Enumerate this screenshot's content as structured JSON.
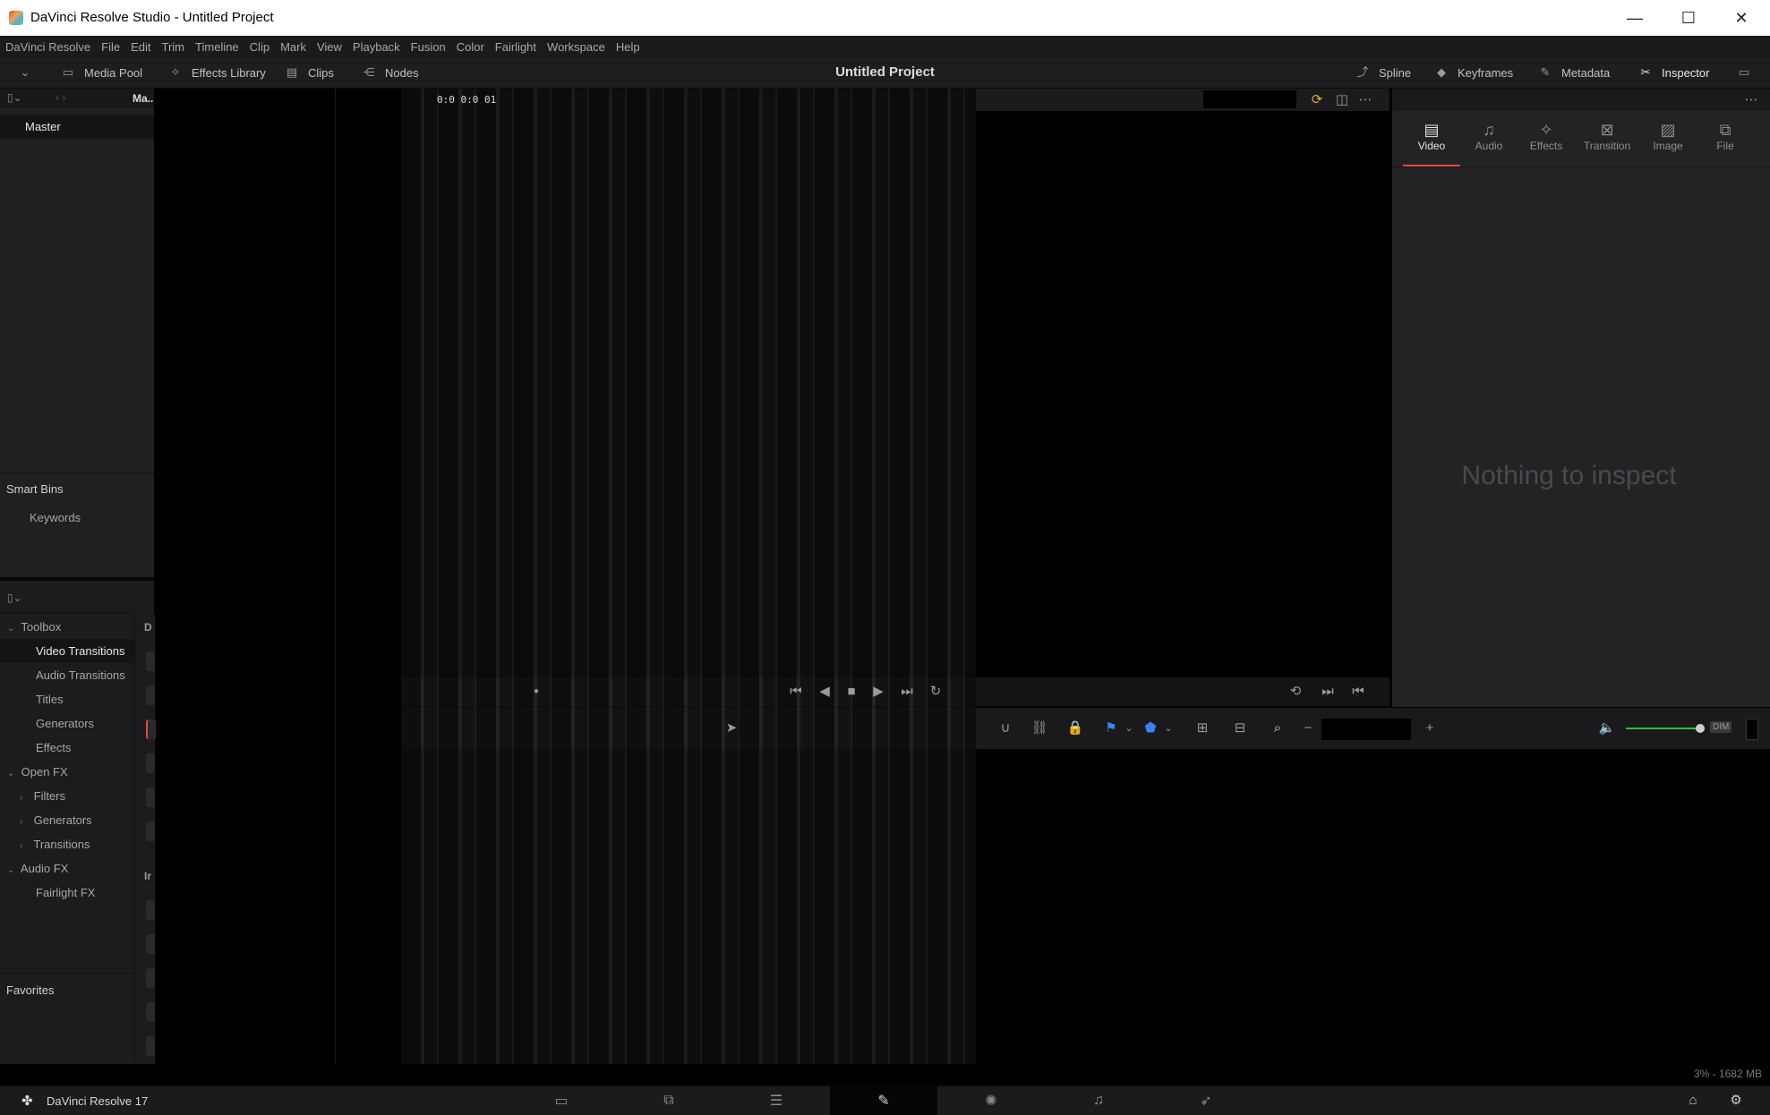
{
  "titlebar": {
    "title": "DaVinci Resolve Studio - Untitled Project",
    "minimize": "—",
    "maximize": "☐",
    "close": "✕"
  },
  "menu": [
    "DaVinci Resolve",
    "File",
    "Edit",
    "Trim",
    "Timeline",
    "Clip",
    "Mark",
    "View",
    "Playback",
    "Fusion",
    "Color",
    "Fairlight",
    "Workspace",
    "Help"
  ],
  "toolbar": {
    "media_pool": "Media Pool",
    "effects_library": "Effects Library",
    "clips": "Clips",
    "nodes": "Nodes",
    "project_title": "Untitled Project",
    "spline": "Spline",
    "keyframes": "Keyframes",
    "metadata": "Metadata",
    "inspector": "Inspector"
  },
  "media_pool": {
    "breadcrumb": "Ma..",
    "master": "Master",
    "smart_bins": "Smart Bins",
    "keywords": "Keywords"
  },
  "effects": {
    "toolbox": "Toolbox",
    "video_transitions": "Video Transitions",
    "audio_transitions": "Audio Transitions",
    "titles": "Titles",
    "generators": "Generators",
    "effects": "Effects",
    "open_fx": "Open FX",
    "filters": "Filters",
    "ofx_generators": "Generators",
    "transitions": "Transitions",
    "audio_fx": "Audio FX",
    "fairlight_fx": "Fairlight FX",
    "favorites": "Favorites",
    "strip_d": "D",
    "strip_i": "Ir"
  },
  "viewer": {
    "timecode": "0:0 0:0 01"
  },
  "inspector": {
    "tabs": [
      "Video",
      "Audio",
      "Effects",
      "Transition",
      "Image",
      "File"
    ],
    "active_tab": "Video",
    "empty_message": "Nothing to inspect"
  },
  "timeline_bar": {
    "dim_label": "DIM",
    "minus": "−",
    "plus": "+"
  },
  "status": {
    "memory": "3% - 1682 MB"
  },
  "bottombar": {
    "version": "DaVinci Resolve 17",
    "active_page": "Fusion"
  },
  "colors": {
    "accent_red": "#e64b3c",
    "volume_green": "#2bbf3e",
    "flag_blue": "#3b82f6"
  }
}
